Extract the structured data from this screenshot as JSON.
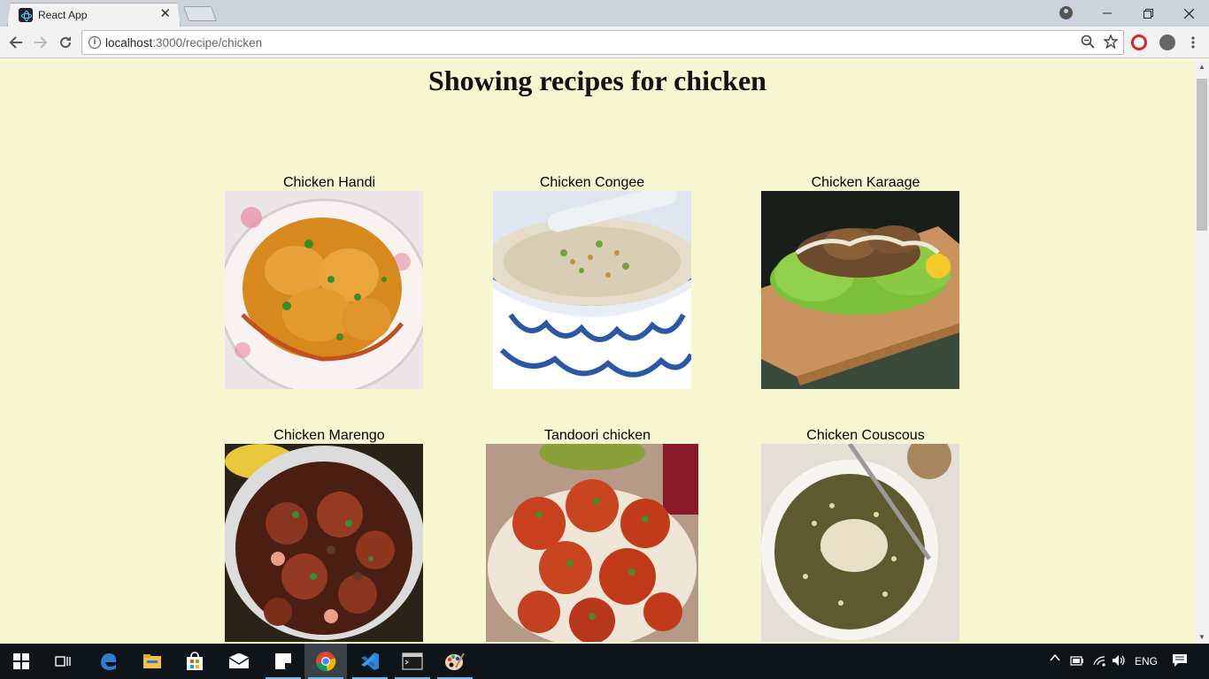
{
  "browser": {
    "tab_title": "React App",
    "tab_close": "✕",
    "url_host": "localhost",
    "url_rest": ":3000/recipe/chicken",
    "colors": {
      "titlebar": "#cdd3da",
      "toolbar": "#f2f2f2",
      "page_bg": "#f6f6d0"
    }
  },
  "page": {
    "heading": "Showing recipes for chicken",
    "recipes": [
      {
        "name": "Chicken Handi"
      },
      {
        "name": "Chicken Congee"
      },
      {
        "name": "Chicken Karaage"
      },
      {
        "name": "Chicken Marengo"
      },
      {
        "name": "Tandoori chicken"
      },
      {
        "name": "Chicken Couscous"
      }
    ]
  },
  "taskbar": {
    "language": "ENG",
    "apps": [
      "start-icon",
      "task-view-icon",
      "edge-icon",
      "file-explorer-icon",
      "store-icon",
      "mail-icon",
      "sticky-notes-icon",
      "chrome-icon",
      "vscode-icon",
      "terminal-icon",
      "paint-icon"
    ]
  }
}
